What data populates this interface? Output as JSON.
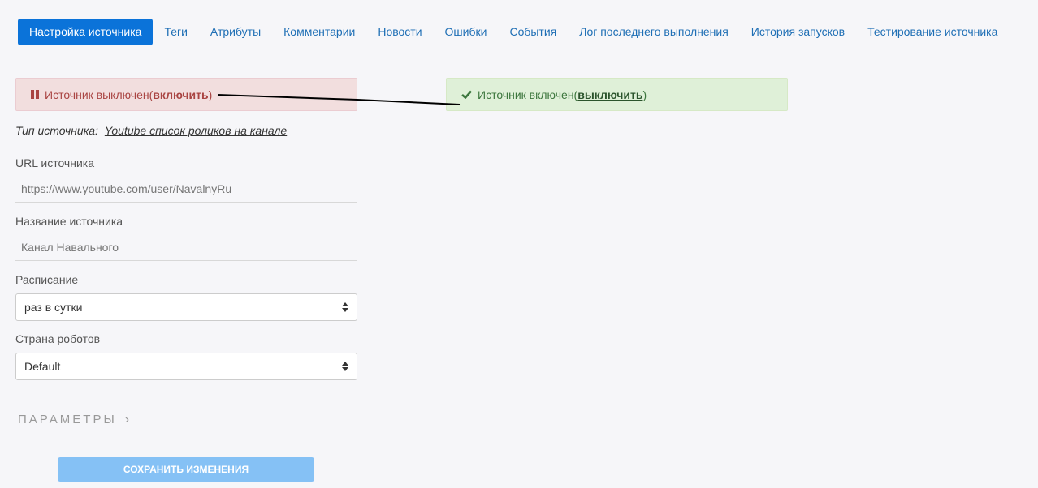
{
  "tabs": [
    {
      "label": "Настройка источника",
      "active": true
    },
    {
      "label": "Теги"
    },
    {
      "label": "Атрибуты"
    },
    {
      "label": "Комментарии"
    },
    {
      "label": "Новости"
    },
    {
      "label": "Ошибки"
    },
    {
      "label": "События"
    },
    {
      "label": "Лог последнего выполнения"
    },
    {
      "label": "История запусков"
    },
    {
      "label": "Тестирование источника"
    }
  ],
  "alerts": {
    "disabled": {
      "text": "Источник выключен(",
      "link": "включить",
      "close": ")",
      "icon": "pause-icon",
      "color": "#a94442"
    },
    "enabled": {
      "text": "Источник включен(",
      "link": "выключить",
      "close": ")",
      "icon": "check-icon",
      "color": "#3c763d"
    }
  },
  "source_type": {
    "label": "Тип источника:",
    "value": "Youtube список роликов на канале"
  },
  "form": {
    "url": {
      "label": "URL источника",
      "placeholder": "https://www.youtube.com/user/NavalnyRu"
    },
    "name": {
      "label": "Название источника",
      "placeholder": "Канал Навального"
    },
    "schedule": {
      "label": "Расписание",
      "value": "раз в сутки"
    },
    "country": {
      "label": "Страна роботов",
      "value": "Default"
    }
  },
  "params": {
    "label": "ПАРАМЕТРЫ",
    "icon": "chevron-right-icon"
  },
  "save_button": {
    "label": "СОХРАНИТЬ ИЗМЕНЕНИЯ"
  },
  "colors": {
    "accent": "#0b73d9",
    "link": "#1f6fb5",
    "button": "#85c1f5"
  }
}
